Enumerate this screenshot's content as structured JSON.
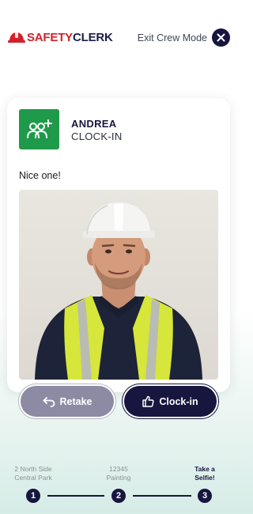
{
  "brand": {
    "name_part1": "SAFETY",
    "name_part2": "CLERK",
    "helmet_color": "#d4202a",
    "text_color": "#1b1f4a"
  },
  "header": {
    "exit_label": "Exit Crew Mode",
    "close_icon": "close-icon"
  },
  "card": {
    "badge_icon": "group-add-icon",
    "badge_color": "#1f9a4a",
    "worker_name": "ANDREA",
    "action": "CLOCK-IN",
    "message": "Nice one!",
    "photo_subject": "selfie-photo"
  },
  "actions": {
    "retake_label": "Retake",
    "retake_icon": "undo-arrow-icon",
    "clockin_label": "Clock-in",
    "clockin_icon": "thumbs-up-icon"
  },
  "steps": [
    {
      "number": "1",
      "line1": "2 North Side",
      "line2": "Central Park",
      "active": false
    },
    {
      "number": "2",
      "line1": "12345",
      "line2": "Painting",
      "active": false
    },
    {
      "number": "3",
      "line1": "Take a",
      "line2": "Selfie!",
      "active": true
    }
  ],
  "colors": {
    "primary": "#16163f",
    "retake": "#8d8ba3",
    "success": "#1f9a4a"
  }
}
